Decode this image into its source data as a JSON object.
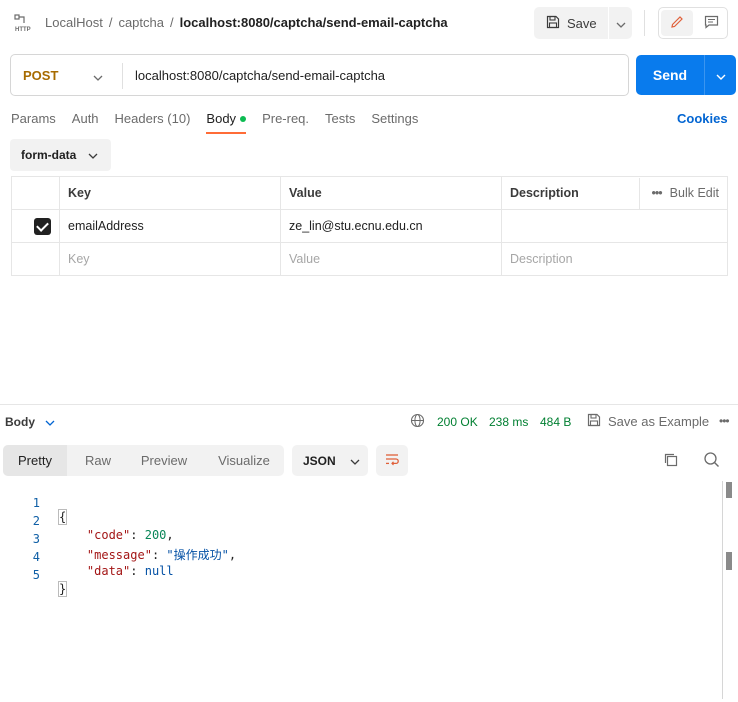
{
  "breadcrumb": {
    "items": [
      "LocalHost",
      "captcha"
    ],
    "current": "localhost:8080/captcha/send-email-captcha"
  },
  "toolbar": {
    "save_label": "Save"
  },
  "request": {
    "method": "POST",
    "url": "localhost:8080/captcha/send-email-captcha",
    "send_label": "Send"
  },
  "tabs": {
    "params": "Params",
    "auth": "Auth",
    "headers": "Headers (10)",
    "body": "Body",
    "prereq": "Pre-req.",
    "tests": "Tests",
    "settings": "Settings",
    "cookies": "Cookies"
  },
  "body_type": "form-data",
  "table": {
    "headers": {
      "key": "Key",
      "value": "Value",
      "description": "Description",
      "bulk_edit": "Bulk Edit"
    },
    "rows": [
      {
        "checked": true,
        "key": "emailAddress",
        "value": "ze_lin@stu.ecnu.edu.cn",
        "description": ""
      }
    ],
    "placeholders": {
      "key": "Key",
      "value": "Value",
      "description": "Description"
    }
  },
  "response": {
    "title": "Body",
    "status": "200 OK",
    "time": "238 ms",
    "size": "484 B",
    "save_example": "Save as Example",
    "tabs": {
      "pretty": "Pretty",
      "raw": "Raw",
      "preview": "Preview",
      "visualize": "Visualize"
    },
    "format": "JSON",
    "code": {
      "line_numbers": [
        "1",
        "2",
        "3",
        "4",
        "5"
      ],
      "open_brace": "{",
      "close_brace": "}",
      "code_key": "\"code\"",
      "code_value": "200",
      "message_key": "\"message\"",
      "message_value": "\"操作成功\"",
      "data_key": "\"data\"",
      "data_value": "null"
    }
  },
  "colors": {
    "accent": "#ff6c37",
    "send": "#097bed",
    "status_ok": "#007f31",
    "method_post": "#a76b00"
  }
}
